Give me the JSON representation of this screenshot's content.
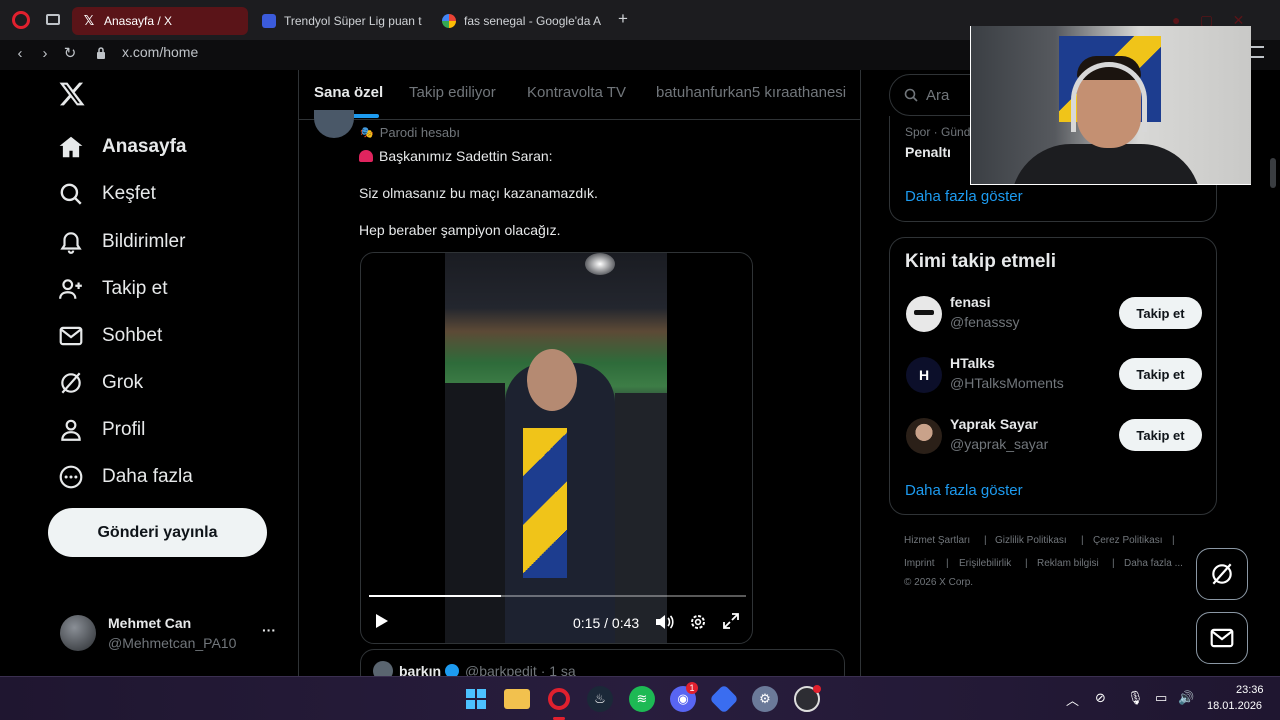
{
  "browser": {
    "tabs": [
      {
        "title": "Anasayfa / X",
        "active": true
      },
      {
        "title": "Trendyol Süper Lig puan t",
        "active": false
      },
      {
        "title": "fas senegal - Google'da A",
        "active": false
      }
    ],
    "url": "x.com/home"
  },
  "sidebar": {
    "items": [
      {
        "label": "Anasayfa",
        "icon": "home-icon"
      },
      {
        "label": "Keşfet",
        "icon": "search-icon"
      },
      {
        "label": "Bildirimler",
        "icon": "bell-icon"
      },
      {
        "label": "Takip et",
        "icon": "follow-icon"
      },
      {
        "label": "Sohbet",
        "icon": "mail-icon"
      },
      {
        "label": "Grok",
        "icon": "grok-icon"
      },
      {
        "label": "Profil",
        "icon": "user-icon"
      },
      {
        "label": "Daha fazla",
        "icon": "more-circle-icon"
      }
    ],
    "post_button": "Gönderi yayınla",
    "account": {
      "name": "Mehmet Can",
      "handle": "@Mehmetcan_PA10",
      "more": "···"
    }
  },
  "feed": {
    "tabs": [
      "Sana özel",
      "Takip ediliyor",
      "Kontravolta TV",
      "batuhanfurkan5 kıraathanesi"
    ],
    "tweet": {
      "label": "Parodi hesabı",
      "lines": [
        "Başkanımız Sadettin Saran:",
        "Siz olmasanız bu maçı kazanamazdık.",
        "Hep beraber şampiyon olacağız."
      ],
      "video": {
        "time": "0:15 / 0:43",
        "progress": 0.35
      }
    },
    "quoted": {
      "name": "barkın",
      "handle": "@barkpedit · 1 sa"
    }
  },
  "right": {
    "search_placeholder": "Ara",
    "trend": {
      "meta": "Spor · Günd",
      "title": "Penaltı",
      "show_more": "Daha fazla göster"
    },
    "who_to_follow": {
      "title": "Kimi takip etmeli",
      "users": [
        {
          "name": "fenasi",
          "handle": "@fenasssy",
          "button": "Takip et"
        },
        {
          "name": "HTalks",
          "handle": "@HTalksMoments",
          "button": "Takip et"
        },
        {
          "name": "Yaprak Sayar",
          "handle": "@yaprak_sayar",
          "button": "Takip et"
        }
      ],
      "show_more": "Daha fazla göster"
    },
    "footer": {
      "row1": [
        "Hizmet Şartları",
        "Gizlilik Politikası",
        "Çerez Politikası"
      ],
      "row2": [
        "Imprint",
        "Erişilebilirlik",
        "Reklam bilgisi",
        "Daha fazla ..."
      ],
      "copyright": "© 2026 X Corp."
    }
  },
  "taskbar": {
    "time": "23:36",
    "date": "18.01.2026",
    "discord_badge": "1"
  }
}
